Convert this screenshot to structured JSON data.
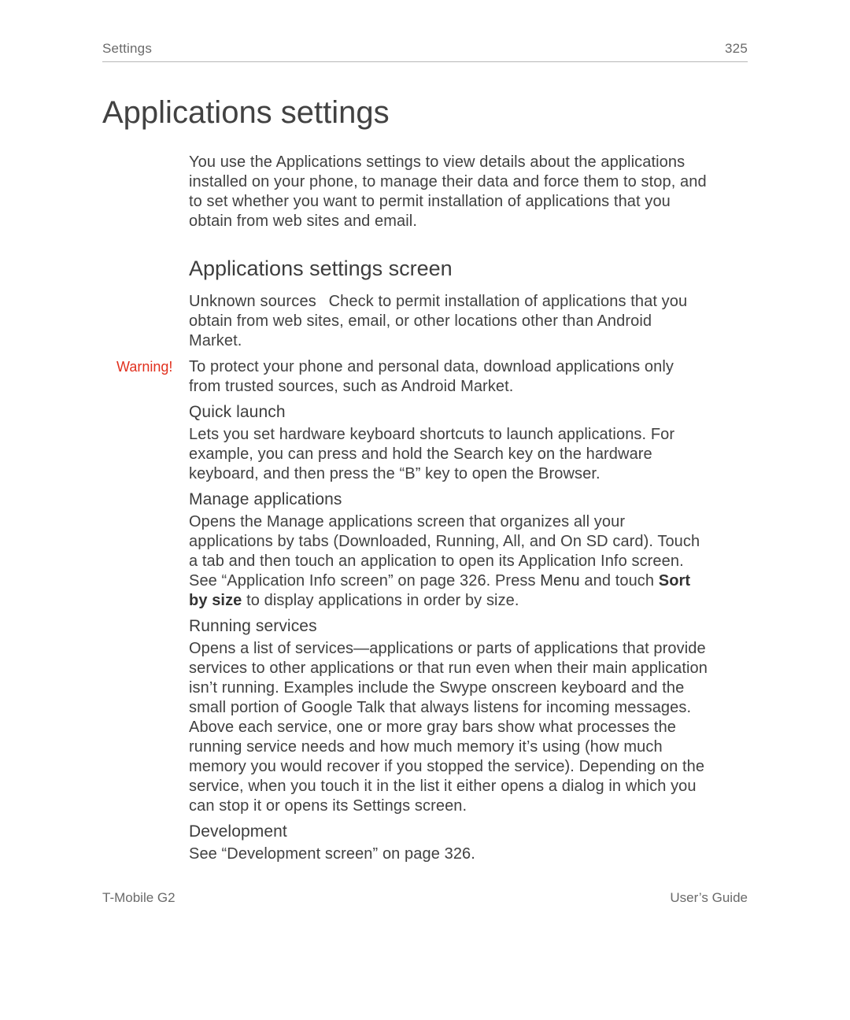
{
  "header": {
    "section": "Settings",
    "page_number": "325"
  },
  "title": "Applications settings",
  "intro": "You use the Applications settings to view details about the applications installed on your phone, to manage their data and force them to stop, and to set whether you want to permit installation of applications that you obtain from web sites and email.",
  "section_heading": "Applications settings screen",
  "unknown_sources": {
    "label": "Unknown sources",
    "text": "Check to permit installation of applications that you obtain from web sites, email, or other locations other than Android Market."
  },
  "warning": {
    "label": "Warning!",
    "text": "To protect your phone and personal data, download applications only from trusted sources, such as Android Market."
  },
  "quick_launch": {
    "heading": "Quick launch",
    "text": "Lets you set hardware keyboard shortcuts to launch applications. For example, you can press and hold the Search key on the hardware keyboard, and then press the “B” key to open the Browser."
  },
  "manage_apps": {
    "heading": "Manage applications",
    "text_pre": "Opens the Manage applications screen that organizes all your applications by tabs (Downloaded, Running, All, and On SD card). Touch a tab and then touch an application to open its Application Info screen. See “Application Info screen” on page 326. Press ",
    "menu_word": "Menu",
    "text_mid": " and touch ",
    "bold_word": "Sort by size",
    "text_post": " to display applications in order by size."
  },
  "running_services": {
    "heading": "Running services",
    "text": "Opens a list of services—applications or parts of applications that provide services to other applications or that run even when their main application isn’t running. Examples include the Swype onscreen keyboard and the small portion of Google Talk that always listens for incoming messages. Above each service, one or more gray bars show what processes the running service needs and how much memory it’s using (how much memory you would recover if you stopped the service). Depending on the service, when you touch it in the list it either opens a dialog in which you can stop it or opens its Settings screen."
  },
  "development": {
    "heading": "Development",
    "text": "See “Development screen” on page 326."
  },
  "footer": {
    "left": "T-Mobile G2",
    "right": "User’s Guide"
  }
}
